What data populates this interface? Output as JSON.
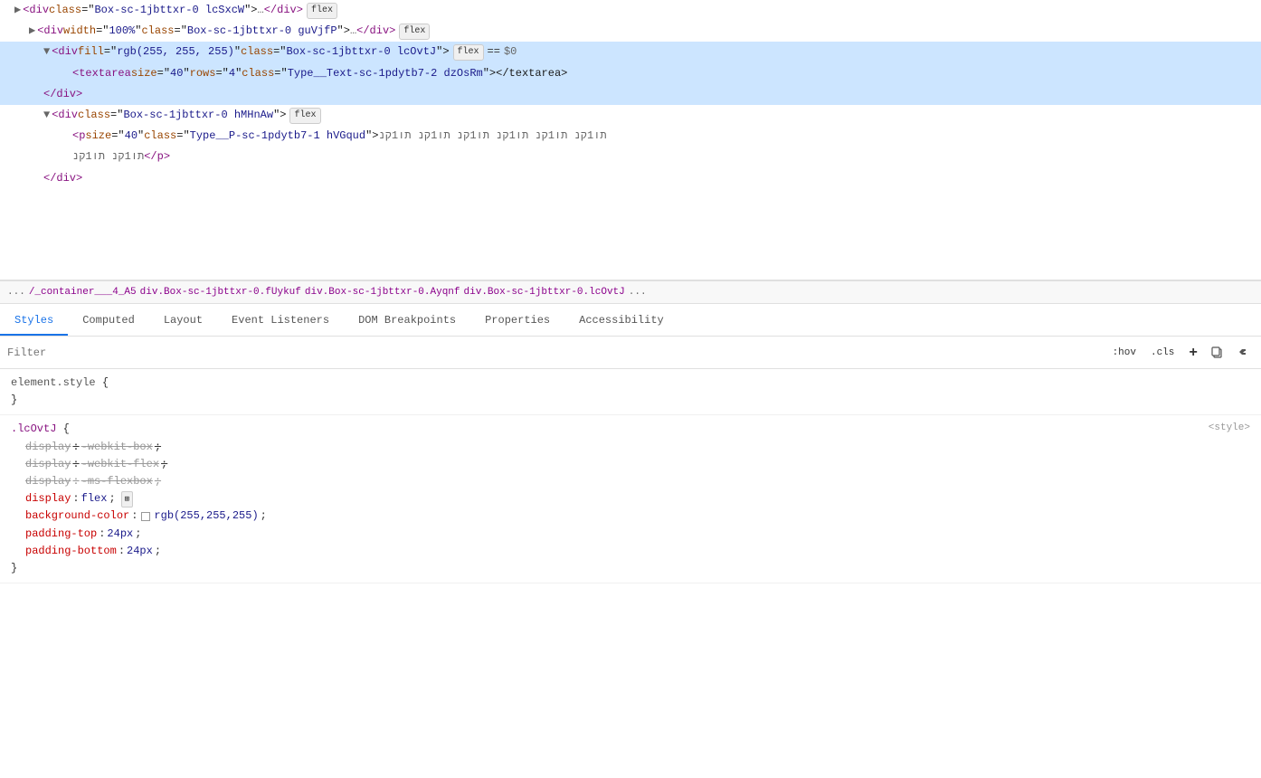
{
  "htmlPanel": {
    "lines": [
      {
        "id": "line1",
        "indent": 0,
        "content": "▶<div class=\"Box-sc-1jbttxr-0 lcSxcW\">…</div>",
        "badge": "flex",
        "selected": false
      },
      {
        "id": "line2",
        "indent": 1,
        "content": "▶<div width=\"100%\" class=\"Box-sc-1jbttxr-0 guVjfP\">…</div>",
        "badge": "flex",
        "selected": false
      },
      {
        "id": "line3",
        "indent": 2,
        "content": "▼<div fill=\"rgb(255, 255, 255)\" class=\"Box-sc-1jbttxr-0 lcOvtJ\">",
        "badge": "flex",
        "equals": "== $0",
        "selected": true
      },
      {
        "id": "line4",
        "indent": 3,
        "content": "<textarea size=\"40\" rows=\"4\" class=\"Type__Text-sc-1pdytb7-2 dzOsRm\"></textarea>",
        "badge": null,
        "selected": true
      },
      {
        "id": "line5",
        "indent": 2,
        "content": "</div>",
        "badge": null,
        "selected": true
      },
      {
        "id": "line6",
        "indent": 2,
        "content": "▼<div class=\"Box-sc-1jbttxr-0 hMHnAw\">",
        "badge": "flex",
        "selected": false
      },
      {
        "id": "line7",
        "indent": 3,
        "content": "<p size=\"40\" class=\"Type__P-sc-1pdytb7-1 hVGqud\">",
        "loremText": "תו1קנ  תו1קנ  תו1קנ  תו1קנ  תו1קנ  תו1קנ  תו1קנ  תו1קנ</p>",
        "selected": false
      },
      {
        "id": "line8",
        "indent": 2,
        "content": "</div>",
        "badge": null,
        "selected": false
      }
    ]
  },
  "breadcrumb": {
    "dots": "...",
    "items": [
      "/_container___4_A5",
      "div.Box-sc-1jbttxr-0.fUykuf",
      "div.Box-sc-1jbttxr-0.Ayqnf",
      "div.Box-sc-1jbttxr-0.lcOvtJ"
    ],
    "endDots": "..."
  },
  "tabs": {
    "items": [
      "Styles",
      "Computed",
      "Layout",
      "Event Listeners",
      "DOM Breakpoints",
      "Properties",
      "Accessibility"
    ],
    "activeIndex": 0
  },
  "filterBar": {
    "placeholder": "Filter",
    "buttons": [
      ":hov",
      ".cls",
      "+"
    ],
    "icons": [
      "copy-icon",
      "back-icon"
    ]
  },
  "stylesPanel": {
    "elementStyle": {
      "selector": "element.style",
      "properties": []
    },
    "rules": [
      {
        "selector": ".lcOvtJ",
        "source": "<style>",
        "properties": [
          {
            "name": "display",
            "value": "-webkit-box",
            "strikethrough": true
          },
          {
            "name": "display",
            "value": "-webkit-flex",
            "strikethrough": true
          },
          {
            "name": "display",
            "value": "-ms-flexbox",
            "strikethrough": true,
            "nameStrike": true
          },
          {
            "name": "display",
            "value": "flex",
            "strikethrough": false,
            "hasGridIcon": true
          },
          {
            "name": "background-color",
            "value": "rgb(255,255,255)",
            "strikethrough": false,
            "hasColorSwatch": true,
            "swatchColor": "#ffffff"
          },
          {
            "name": "padding-top",
            "value": "24px",
            "strikethrough": false
          },
          {
            "name": "padding-bottom",
            "value": "24px",
            "strikethrough": false
          }
        ]
      }
    ]
  }
}
